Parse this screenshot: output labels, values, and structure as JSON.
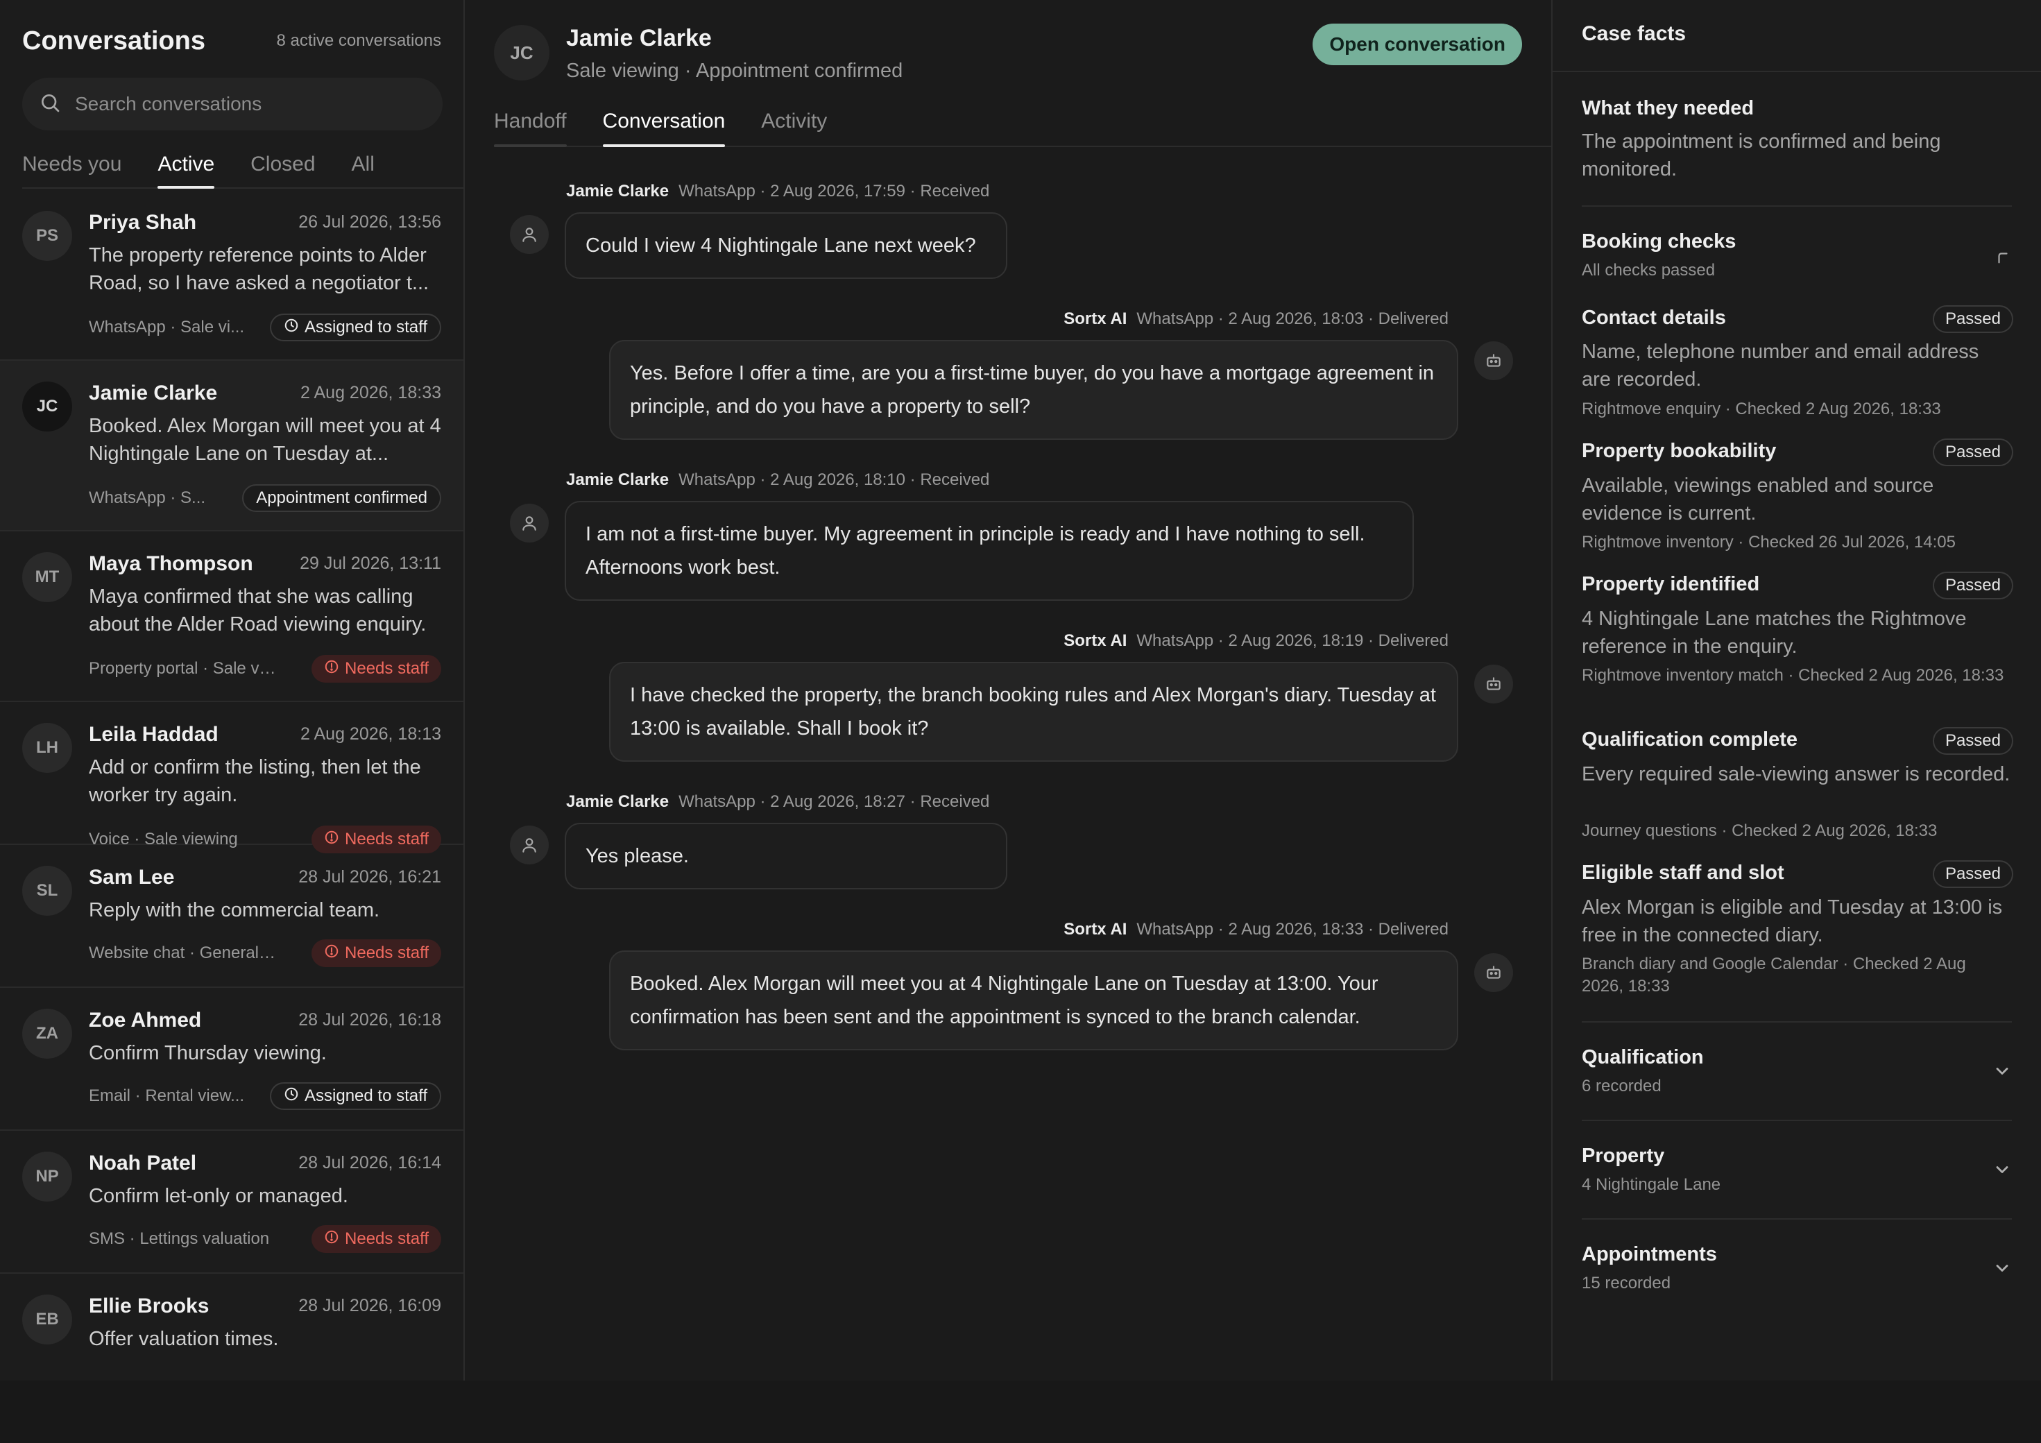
{
  "sidebar": {
    "title": "Conversations",
    "active_count": "8 active conversations",
    "search_placeholder": "Search conversations",
    "tabs": [
      "Needs you",
      "Active",
      "Closed",
      "All"
    ],
    "selected_tab": "Active",
    "conversations": [
      {
        "initials": "PS",
        "name": "Priya Shah",
        "date": "26 Jul 2026, 13:56",
        "preview": "The property reference points to Alder Road, so I have asked a negotiator t...",
        "meta": "WhatsApp · Sale vi...",
        "badge": "Assigned to staff",
        "badge_type": "assigned"
      },
      {
        "initials": "JC",
        "name": "Jamie Clarke",
        "date": "2 Aug 2026, 18:33",
        "preview": "Booked. Alex Morgan will meet you at 4 Nightingale Lane on Tuesday at...",
        "meta": "WhatsApp · S...",
        "badge": "Appointment confirmed",
        "badge_type": "confirmed"
      },
      {
        "initials": "MT",
        "name": "Maya Thompson",
        "date": "29 Jul 2026, 13:11",
        "preview": "Maya confirmed that she was calling about the Alder Road viewing enquiry.",
        "meta": "Property portal · Sale vi...",
        "badge": "Needs staff",
        "badge_type": "needs"
      },
      {
        "initials": "LH",
        "name": "Leila Haddad",
        "date": "2 Aug 2026, 18:13",
        "preview": "Add or confirm the listing, then let the worker try again.",
        "meta": "Voice · Sale viewing",
        "badge": "Needs staff",
        "badge_type": "needs"
      },
      {
        "initials": "SL",
        "name": "Sam Lee",
        "date": "28 Jul 2026, 16:21",
        "preview": "Reply with the commercial team.",
        "meta": "Website chat · General ...",
        "badge": "Needs staff",
        "badge_type": "needs"
      },
      {
        "initials": "ZA",
        "name": "Zoe Ahmed",
        "date": "28 Jul 2026, 16:18",
        "preview": "Confirm Thursday viewing.",
        "meta": "Email · Rental view...",
        "badge": "Assigned to staff",
        "badge_type": "assigned"
      },
      {
        "initials": "NP",
        "name": "Noah Patel",
        "date": "28 Jul 2026, 16:14",
        "preview": "Confirm let-only or managed.",
        "meta": "SMS · Lettings valuation",
        "badge": "Needs staff",
        "badge_type": "needs"
      },
      {
        "initials": "EB",
        "name": "Ellie Brooks",
        "date": "28 Jul 2026, 16:09",
        "preview": "Offer valuation times.",
        "meta": "",
        "badge": "",
        "badge_type": ""
      }
    ]
  },
  "conversation": {
    "initials": "JC",
    "name": "Jamie Clarke",
    "subtitle": "Sale viewing · Appointment confirmed",
    "open_button": "Open conversation",
    "tabs": [
      "Handoff",
      "Conversation",
      "Activity"
    ],
    "selected_tab": "Conversation",
    "messages": [
      {
        "sender": "Jamie Clarke",
        "meta": "WhatsApp · 2 Aug 2026, 17:59 · Received",
        "text": "Could I view 4 Nightingale Lane next week?",
        "direction": "in"
      },
      {
        "sender": "Sortx AI",
        "meta": "WhatsApp · 2 Aug 2026, 18:03 · Delivered",
        "text": "Yes. Before I offer a time, are you a first-time buyer, do you have a mortgage agreement in principle, and do you have a property to sell?",
        "direction": "out"
      },
      {
        "sender": "Jamie Clarke",
        "meta": "WhatsApp · 2 Aug 2026, 18:10 · Received",
        "text": "I am not a first-time buyer. My agreement in principle is ready and I have nothing to sell. Afternoons work best.",
        "direction": "in"
      },
      {
        "sender": "Sortx AI",
        "meta": "WhatsApp · 2 Aug 2026, 18:19 · Delivered",
        "text": "I have checked the property, the branch booking rules and Alex Morgan's diary. Tuesday at 13:00 is available. Shall I book it?",
        "direction": "out"
      },
      {
        "sender": "Jamie Clarke",
        "meta": "WhatsApp · 2 Aug 2026, 18:27 · Received",
        "text": "Yes please.",
        "direction": "in"
      },
      {
        "sender": "Sortx AI",
        "meta": "WhatsApp · 2 Aug 2026, 18:33 · Delivered",
        "text": "Booked. Alex Morgan will meet you at 4 Nightingale Lane on Tuesday at 13:00. Your confirmation has been sent and the appointment is synced to the branch calendar.",
        "direction": "out"
      }
    ]
  },
  "case_facts": {
    "title": "Case facts",
    "need_title": "What they needed",
    "need_text": "The appointment is confirmed and being monitored.",
    "booking_checks": {
      "title": "Booking checks",
      "summary": "All checks passed",
      "checks": [
        {
          "title": "Contact details",
          "status": "Passed",
          "text": "Name, telephone number and email address are recorded.",
          "source": "Rightmove enquiry · Checked 2 Aug 2026, 18:33"
        },
        {
          "title": "Property bookability",
          "status": "Passed",
          "text": "Available, viewings enabled and source evidence is current.",
          "source": "Rightmove inventory · Checked 26 Jul 2026, 14:05"
        },
        {
          "title": "Property identified",
          "status": "Passed",
          "text": "4 Nightingale Lane matches the Rightmove reference in the enquiry.",
          "source": "Rightmove inventory match · Checked 2 Aug 2026, 18:33"
        },
        {
          "title": "Qualification complete",
          "status": "Passed",
          "text": "Every required sale-viewing answer is recorded.",
          "source": "Journey questions · Checked 2 Aug 2026, 18:33"
        },
        {
          "title": "Eligible staff and slot",
          "status": "Passed",
          "text": "Alex Morgan is eligible and Tuesday at 13:00 is free in the connected diary.",
          "source": "Branch diary and Google Calendar · Checked 2 Aug 2026, 18:33"
        }
      ]
    },
    "sections": [
      {
        "title": "Qualification",
        "summary": "6 recorded"
      },
      {
        "title": "Property",
        "summary": "4 Nightingale Lane"
      },
      {
        "title": "Appointments",
        "summary": "15 recorded"
      }
    ]
  },
  "colors": {
    "accent": "#76b09a",
    "danger": "#f06a5f",
    "background": "#181818"
  },
  "icons": {
    "search": "search-icon",
    "person": "user-icon",
    "bot": "bot-icon",
    "clock": "clock-icon",
    "alert": "alert-circle-icon",
    "chevron": "chevron-down-icon"
  }
}
